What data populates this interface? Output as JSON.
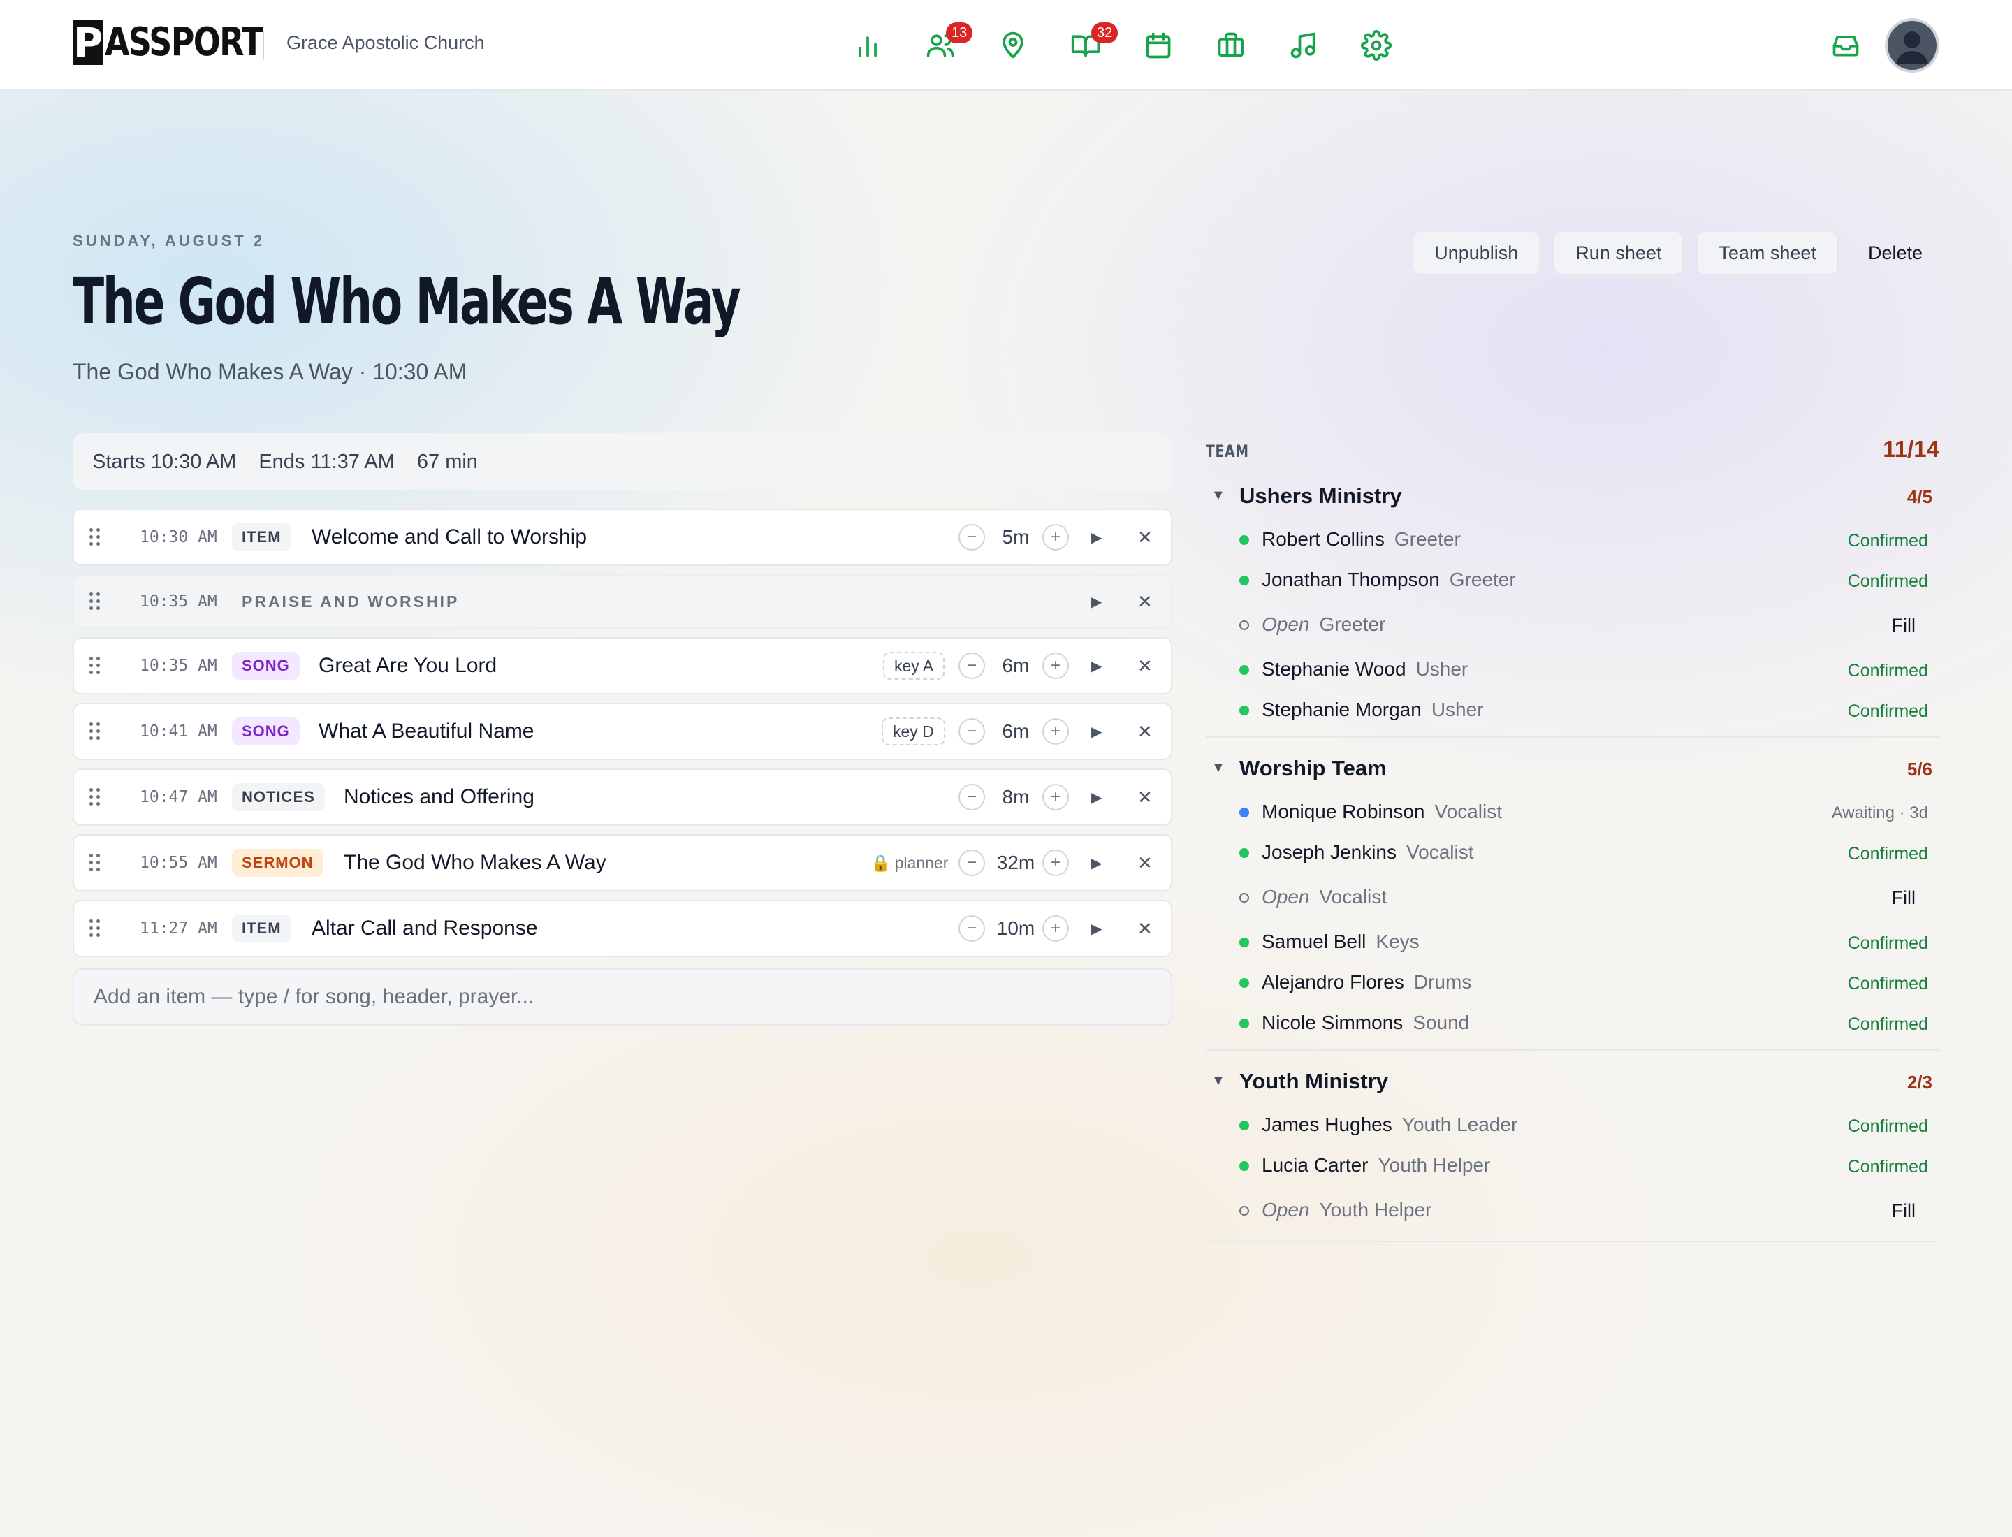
{
  "header": {
    "logo_letter": "P",
    "logo_rest": "ASSPORT",
    "church": "Grace Apostolic Church",
    "nav": [
      {
        "icon": "bar-chart-icon",
        "badge": ""
      },
      {
        "icon": "users-icon",
        "badge": "13"
      },
      {
        "icon": "map-pin-icon",
        "badge": ""
      },
      {
        "icon": "book-open-icon",
        "badge": "32"
      },
      {
        "icon": "calendar-icon",
        "badge": ""
      },
      {
        "icon": "briefcase-icon",
        "badge": ""
      },
      {
        "icon": "music-icon",
        "badge": ""
      },
      {
        "icon": "gear-icon",
        "badge": ""
      }
    ],
    "accent_color": "#16a34a"
  },
  "service": {
    "date": "SUNDAY, AUGUST 2",
    "title": "The God Who Makes A Way",
    "subtitle": "The God Who Makes A Way · 10:30 AM",
    "actions": {
      "unpublish": "Unpublish",
      "run_sheet": "Run sheet",
      "team_sheet": "Team sheet",
      "delete": "Delete"
    },
    "summary": {
      "starts": "Starts 10:30 AM",
      "ends": "Ends 11:37 AM",
      "duration": "67 min"
    },
    "items": [
      {
        "time": "10:30 AM",
        "tag": "ITEM",
        "label": "Welcome and Call to Worship",
        "duration": "5m"
      },
      {
        "time": "10:35 AM",
        "header": "PRAISE AND WORSHIP"
      },
      {
        "time": "10:35 AM",
        "tag": "SONG",
        "label": "Great Are You Lord",
        "key": "key A",
        "duration": "6m"
      },
      {
        "time": "10:41 AM",
        "tag": "SONG",
        "label": "What A Beautiful Name",
        "key": "key D",
        "duration": "6m"
      },
      {
        "time": "10:47 AM",
        "tag": "NOTICES",
        "label": "Notices and Offering",
        "duration": "8m"
      },
      {
        "time": "10:55 AM",
        "tag": "SERMON",
        "label": "The God Who Makes A Way",
        "planner": "planner",
        "duration": "32m"
      },
      {
        "time": "11:27 AM",
        "tag": "ITEM",
        "label": "Altar Call and Response",
        "duration": "10m"
      }
    ],
    "add_placeholder": "Add an item — type / for song, header, prayer..."
  },
  "team": {
    "title": "TEAM",
    "count": "11/14",
    "groups": [
      {
        "name": "Ushers Ministry",
        "count": "4/5",
        "members": [
          {
            "name": "Robert Collins",
            "role": "Greeter",
            "status": "Confirmed"
          },
          {
            "name": "Jonathan Thompson",
            "role": "Greeter",
            "status": "Confirmed"
          },
          {
            "open": "Open",
            "role": "Greeter",
            "action": "Fill"
          },
          {
            "name": "Stephanie Wood",
            "role": "Usher",
            "status": "Confirmed"
          },
          {
            "name": "Stephanie Morgan",
            "role": "Usher",
            "status": "Confirmed"
          }
        ]
      },
      {
        "name": "Worship Team",
        "count": "5/6",
        "members": [
          {
            "name": "Monique Robinson",
            "role": "Vocalist",
            "status": "Awaiting · 3d",
            "awaiting": true
          },
          {
            "name": "Joseph Jenkins",
            "role": "Vocalist",
            "status": "Confirmed"
          },
          {
            "open": "Open",
            "role": "Vocalist",
            "action": "Fill"
          },
          {
            "name": "Samuel Bell",
            "role": "Keys",
            "status": "Confirmed"
          },
          {
            "name": "Alejandro Flores",
            "role": "Drums",
            "status": "Confirmed"
          },
          {
            "name": "Nicole Simmons",
            "role": "Sound",
            "status": "Confirmed"
          }
        ]
      },
      {
        "name": "Youth Ministry",
        "count": "2/3",
        "members": [
          {
            "name": "James Hughes",
            "role": "Youth Leader",
            "status": "Confirmed"
          },
          {
            "name": "Lucia Carter",
            "role": "Youth Helper",
            "status": "Confirmed"
          },
          {
            "open": "Open",
            "role": "Youth Helper",
            "action": "Fill"
          }
        ]
      }
    ]
  }
}
